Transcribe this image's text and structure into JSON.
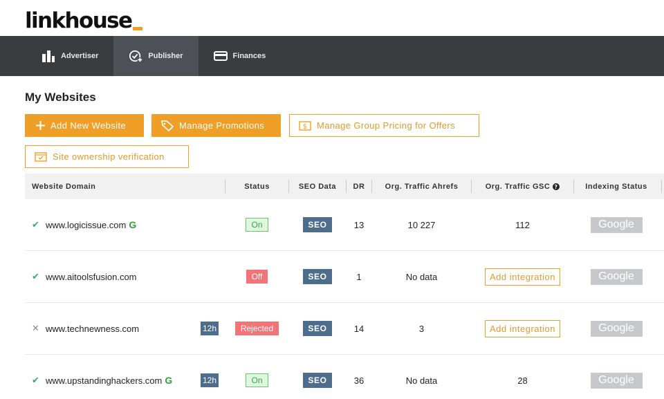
{
  "brand": {
    "name": "linkhouse"
  },
  "nav": {
    "items": [
      {
        "label": "Advertiser",
        "icon": "bar-chart-icon"
      },
      {
        "label": "Publisher",
        "icon": "badge-plus-icon"
      },
      {
        "label": "Finances",
        "icon": "wallet-icon"
      }
    ],
    "active": "Publisher"
  },
  "page": {
    "title": "My Websites"
  },
  "actions": {
    "add_website": "Add New Website",
    "manage_promotions": "Manage Promotions",
    "group_pricing": "Manage Group Pricing for Offers",
    "ownership": "Site ownership verification"
  },
  "table": {
    "headers": {
      "domain": "Website Domain",
      "status": "Status",
      "seo": "SEO Data",
      "dr": "DR",
      "ahrefs": "Org. Traffic Ahrefs",
      "gsc": "Org. Traffic GSC",
      "indexing": "Indexing Status"
    },
    "rows": [
      {
        "verified": "✔",
        "domain": "www.logicissue.com",
        "g": "G",
        "tag": "",
        "status": "On",
        "seo": "SEO",
        "dr": "13",
        "ahrefs": "10 227",
        "gsc": "112",
        "gsc_action": "",
        "indexing": "Google"
      },
      {
        "verified": "✔",
        "domain": "www.aitoolsfusion.com",
        "g": "",
        "tag": "",
        "status": "Off",
        "seo": "SEO",
        "dr": "1",
        "ahrefs": "No data",
        "gsc": "",
        "gsc_action": "Add integration",
        "indexing": "Google"
      },
      {
        "verified": "✕",
        "domain": "www.technewness.com",
        "g": "",
        "tag": "12h",
        "status": "Rejected",
        "seo": "SEO",
        "dr": "14",
        "ahrefs": "3",
        "gsc": "",
        "gsc_action": "Add integration",
        "indexing": "Google"
      },
      {
        "verified": "✔",
        "domain": "www.upstandinghackers.com",
        "g": "G",
        "tag": "12h",
        "status": "On",
        "seo": "SEO",
        "dr": "36",
        "ahrefs": "No data",
        "gsc": "28",
        "gsc_action": "",
        "indexing": "Google"
      }
    ]
  },
  "colors": {
    "accent": "#ef9f27",
    "nav_bg": "#3a3d40",
    "seo_badge": "#4e6d8c",
    "status_off": "#f07478",
    "status_on": "#dff6df"
  }
}
